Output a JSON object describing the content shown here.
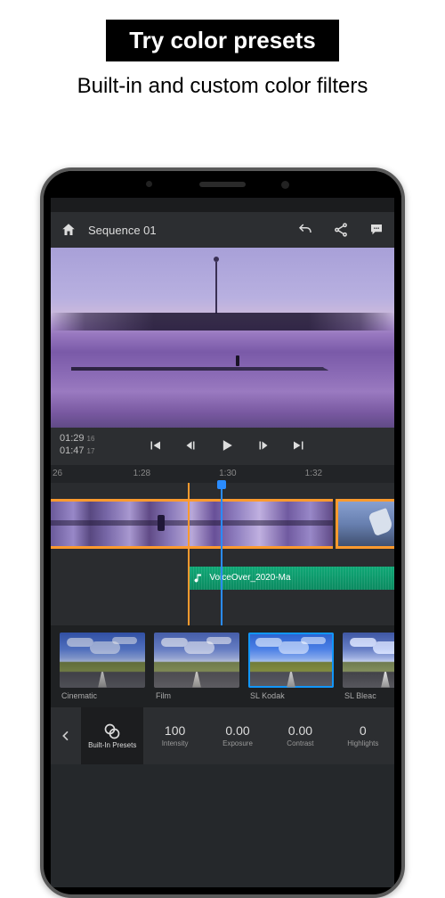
{
  "promo": {
    "headline": "Try color presets",
    "subline": "Built-in and custom color filters"
  },
  "header": {
    "title": "Sequence 01"
  },
  "timecode": {
    "current": "01:29",
    "current_frames": "16",
    "out": "01:47",
    "out_frames": "17"
  },
  "ruler": {
    "t0": "26",
    "t1": "1:28",
    "t2": "1:30",
    "t3": "1:32"
  },
  "audio": {
    "clip_name": "VoiceOver_2020-Ma"
  },
  "presets": {
    "items": [
      {
        "label": "Cinematic"
      },
      {
        "label": "Film"
      },
      {
        "label": "SL Kodak"
      },
      {
        "label": "SL Bleac"
      }
    ]
  },
  "adjust": {
    "back": "‹",
    "items": [
      {
        "label": "Built-In Presets",
        "value": ""
      },
      {
        "label": "Intensity",
        "value": "100"
      },
      {
        "label": "Exposure",
        "value": "0.00"
      },
      {
        "label": "Contrast",
        "value": "0.00"
      },
      {
        "label": "Highlights",
        "value": "0"
      }
    ]
  }
}
